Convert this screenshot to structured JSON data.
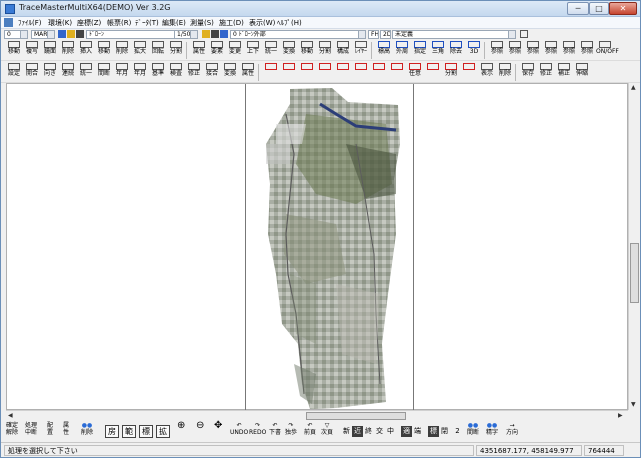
{
  "window": {
    "title": "TraceMasterMultiX64(DEMO)   Ver 3.2G",
    "controls": [
      "─",
      "□",
      "✕"
    ]
  },
  "menu": [
    "ﾌｧｲﾙ(F)",
    "環境(K)",
    "座標(Z)",
    "帳票(R)",
    "ﾃﾞｰﾀ(T)",
    "編集(E)",
    "測量(S)",
    "施工(D)",
    "表示(W)",
    "ﾍﾙﾌﾟ(H)"
  ],
  "combos": {
    "layer_no": "0",
    "line_type": "MAR",
    "pen": "ﾄﾞﾛｰﾝ",
    "scale": "1/500",
    "layer_name": "0 ﾄﾞﾛｰﾝ外部",
    "fh": "FH",
    "dim": "2D",
    "mode": "未定義"
  },
  "toolbar1": [
    [
      "部分",
      "移動"
    ],
    [
      "部分",
      "複写"
    ],
    [
      "回転",
      "鏡面"
    ],
    [
      "",
      "削除"
    ],
    [
      "点",
      "挿入"
    ],
    [
      "点",
      "移動"
    ],
    [
      "点",
      "削除"
    ],
    [
      "画面",
      "拡大"
    ],
    [
      "画面",
      "回転"
    ],
    [
      "背景",
      "分割"
    ],
    [
      "表示",
      "属性"
    ],
    [
      "図面",
      "要素"
    ],
    [
      "要素",
      "変更"
    ],
    [
      "ﾚｲﾔｰ",
      "上下"
    ],
    [
      "ﾚｲﾔｰ",
      "統一"
    ],
    [
      "座標",
      "変換"
    ],
    [
      "背面",
      "移動"
    ],
    [
      "要素",
      "分割"
    ],
    [
      "追加",
      "構成"
    ],
    [
      "SXF",
      "ﾚｲﾔｰ"
    ],
    [
      "",
      "標高"
    ],
    [
      "",
      "外周"
    ],
    [
      "",
      "指定"
    ],
    [
      "",
      "三角"
    ],
    [
      "",
      "除去"
    ],
    [
      "",
      "3D"
    ],
    [
      "距離",
      "参照"
    ],
    [
      "角度",
      "参照"
    ],
    [
      "面積",
      "参照"
    ],
    [
      "座標",
      "参照"
    ],
    [
      "座標",
      "参照"
    ],
    [
      "SXF",
      "参照"
    ],
    [
      "中ｸﾞ",
      "ON/OFF"
    ]
  ],
  "toolbar2": [
    [
      "",
      "設定"
    ],
    [
      "",
      "開合"
    ],
    [
      "",
      "向き"
    ],
    [
      "",
      "連続"
    ],
    [
      "",
      "統一"
    ],
    [
      "",
      "間断"
    ],
    [
      "",
      "年月"
    ],
    [
      "更新",
      "年月"
    ],
    [
      "製図",
      "基準"
    ],
    [
      "論理",
      "検査"
    ],
    [
      "自動",
      "修正"
    ],
    [
      "図",
      "接合"
    ],
    [
      "図形",
      "変換"
    ],
    [
      "DM",
      "属性"
    ],
    [
      "",
      ""
    ],
    [
      "",
      ""
    ],
    [
      "",
      ""
    ],
    [
      "",
      ""
    ],
    [
      "",
      ""
    ],
    [
      "",
      ""
    ],
    [
      "",
      ""
    ],
    [
      "",
      ""
    ],
    [
      "",
      "任意"
    ],
    [
      "",
      ""
    ],
    [
      "",
      "分割"
    ],
    [
      "",
      ""
    ],
    [
      "補助",
      "表示"
    ],
    [
      "補助",
      "削除"
    ],
    [
      "",
      "保存"
    ],
    [
      "ﾗｽﾀｰ",
      "修正"
    ],
    [
      "ﾗｽﾀｰ",
      "補正"
    ],
    [
      "ﾗｽﾀｰ",
      "伸縮"
    ]
  ],
  "bottom": {
    "confirm": [
      "確定",
      "解除"
    ],
    "process": [
      "処理",
      "中断"
    ],
    "place": [
      "配",
      "置"
    ],
    "attr": [
      "属",
      "性"
    ],
    "measure": [
      "",
      "削除"
    ],
    "mode_buttons": [
      "房",
      "範",
      "標",
      "拡"
    ],
    "undo": "UNDO",
    "redo": "REDO",
    "prev": "下書",
    "sel": "独歩",
    "prev_page": "前頁",
    "next_page": "次頁",
    "text_btns": [
      "新",
      "近",
      "終",
      "交",
      "中",
      "適",
      "端",
      "標",
      "閉",
      "2"
    ],
    "interp": "間断",
    "precision": "精字",
    "direction": "方向"
  },
  "status": {
    "message": "処理を選択して下さい",
    "coords": "4351687.177, 458149.977",
    "count": "764444"
  }
}
